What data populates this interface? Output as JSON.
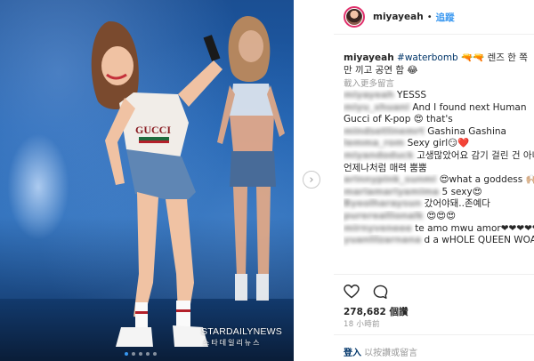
{
  "post": {
    "watermark": "STARDAILYNEWS",
    "watermark_sub": "스타데일리뉴스",
    "carousel_dots": 5,
    "carousel_active": 0
  },
  "header": {
    "username": "miyayeah",
    "separator": "•",
    "follow_label": "追蹤"
  },
  "caption": {
    "username": "miyayeah",
    "hashtag": "#waterbomb",
    "text": "🔫🔫 렌즈 한 쪽만 끼고 공연 함 😂"
  },
  "load_more_label": "載入更多留言",
  "comments": [
    {
      "user": "miyayeah",
      "text": "YESSS"
    },
    {
      "user": "miyu_xhuani",
      "text": "And I found next Human"
    },
    {
      "user": "",
      "text": "Gucci of K-pop 😍 that's"
    },
    {
      "user": "mindsetlinemrt",
      "text": "Gashina Gashina"
    },
    {
      "user": "lemma_rom",
      "text": "Sexy girl😏❤️"
    },
    {
      "user": "miyandoduck",
      "text": "고생많았어요 감기 걸린 건 아니죠?"
    },
    {
      "user": "",
      "text": "언제나처럼 매력 뿜뿜"
    },
    {
      "user": "arinnypink_sunmi",
      "text": "😍what a goddess 🙌🏼💗"
    },
    {
      "user": "mariamariyamima",
      "text": "5 sexy😍"
    },
    {
      "user": "Byeolharaysun",
      "text": "갔어야돼..존예다"
    },
    {
      "user": "purereallionalk",
      "text": "😍😍😍"
    },
    {
      "user": "mirnyveneee",
      "text": "te amo mwu amor❤❤❤❤❤❤"
    },
    {
      "user": "yuanlilzarnana",
      "text": "d a wHOLE QUEEN WOAAHHH 😭"
    }
  ],
  "likes": "278,682 個讚",
  "time": "18 小時前",
  "footer": {
    "login_label": "登入",
    "rest": " 以按讚或留言"
  },
  "colors": {
    "accent": "#3897f0",
    "story_ring": "#e1306c",
    "hashtag": "#003569"
  }
}
